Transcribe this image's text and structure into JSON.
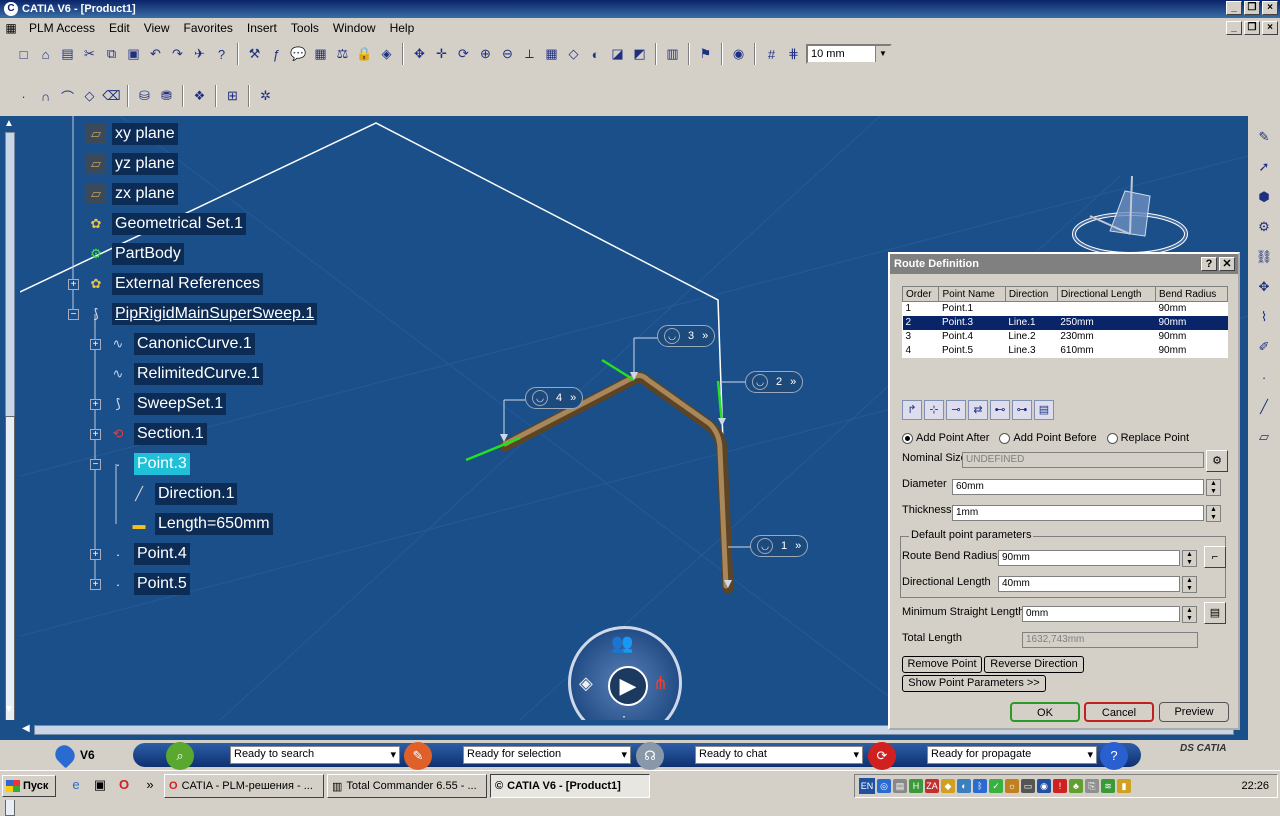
{
  "window": {
    "title": "CATIA V6 - [Product1]"
  },
  "menu": [
    "PLM Access",
    "Edit",
    "View",
    "Favorites",
    "Insert",
    "Tools",
    "Window",
    "Help"
  ],
  "toolbar": {
    "scale_value": "10 mm"
  },
  "tree": [
    {
      "label": "xy plane",
      "icon": "plane-icon"
    },
    {
      "label": "yz plane",
      "icon": "plane-icon"
    },
    {
      "label": "zx plane",
      "icon": "plane-icon"
    },
    {
      "label": "Geometrical Set.1",
      "icon": "geometrical-set-icon"
    },
    {
      "label": "PartBody",
      "icon": "gear-icon"
    },
    {
      "label": "External References",
      "icon": "geometrical-set-icon"
    },
    {
      "label": "PipRigidMainSuperSweep.1",
      "icon": "sweep-icon"
    },
    {
      "label": "CanonicCurve.1",
      "icon": "curve-icon"
    },
    {
      "label": "RelimitedCurve.1",
      "icon": "curve-icon"
    },
    {
      "label": "SweepSet.1",
      "icon": "sweep-icon"
    },
    {
      "label": "Section.1",
      "icon": "section-icon"
    },
    {
      "label": "Point.3",
      "icon": "point-icon"
    },
    {
      "label": "Direction.1",
      "icon": "direction-icon"
    },
    {
      "label": "Length=650mm",
      "icon": "length-icon"
    },
    {
      "label": "Point.4",
      "icon": "point-icon"
    },
    {
      "label": "Point.5",
      "icon": "point-icon"
    }
  ],
  "point_labels": [
    "1",
    "2",
    "3",
    "4"
  ],
  "dialog": {
    "title": "Route Definition",
    "help": "?",
    "close": "✕",
    "columns": [
      "Order",
      "Point Name",
      "Direction",
      "Directional Length",
      "Bend Radius"
    ],
    "rows": [
      [
        "1",
        "Point.1",
        "",
        "",
        "90mm"
      ],
      [
        "2",
        "Point.3",
        "Line.1",
        "250mm",
        "90mm"
      ],
      [
        "3",
        "Point.4",
        "Line.2",
        "230mm",
        "90mm"
      ],
      [
        "4",
        "Point.5",
        "Line.3",
        "610mm",
        "90mm"
      ]
    ],
    "selected_row": 1,
    "radio": {
      "after": "Add Point After",
      "before": "Add Point Before",
      "replace": "Replace Point"
    },
    "nominal_size_label": "Nominal Size",
    "nominal_size": "UNDEFINED",
    "diameter_label": "Diameter",
    "diameter": "60mm",
    "thickness_label": "Thickness",
    "thickness": "1mm",
    "default_group": "Default point parameters",
    "bend_radius_label": "Route Bend Radius",
    "bend_radius": "90mm",
    "dir_length_label": "Directional Length",
    "dir_length": "40mm",
    "min_straight_label": "Minimum Straight Length",
    "min_straight": "0mm",
    "total_length_label": "Total Length",
    "total_length": "1632,743mm",
    "remove_point": "Remove Point",
    "reverse_direction": "Reverse Direction",
    "show_params": "Show Point Parameters >>",
    "ok": "OK",
    "cancel": "Cancel",
    "preview": "Preview"
  },
  "statusbar": {
    "brand": "V6",
    "search": "Ready to search",
    "selection": "Ready for selection",
    "chat": "Ready to chat",
    "propagate": "Ready for propagate",
    "logo": "CATIA"
  },
  "taskbar": {
    "start": "Пуск",
    "tasks": [
      "CATIA - PLM-решения - ...",
      "Total Commander 6.55 - ...",
      "CATIA V6 - [Product1]"
    ],
    "lang": "EN",
    "clock": "22:26"
  },
  "colors": {
    "viewport": "#1a4f8a",
    "pipe": "#8b6a3e",
    "select": "#0a246a",
    "tree_selected": "#20c0d8"
  }
}
